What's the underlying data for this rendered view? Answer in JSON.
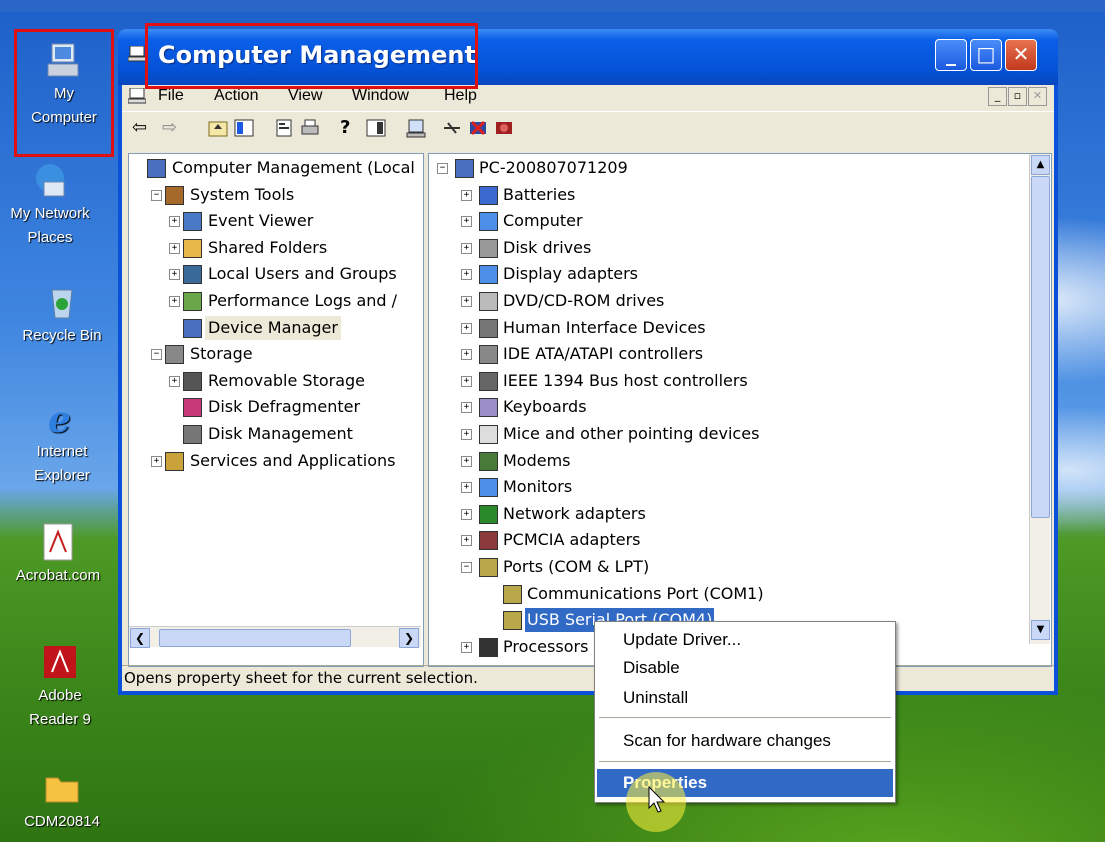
{
  "desktop": {
    "icons": [
      {
        "label_line1": "My",
        "label_line2": "Computer"
      },
      {
        "label_line1": "My Network",
        "label_line2": "Places"
      },
      {
        "label_line1": "Recycle Bin",
        "label_line2": ""
      },
      {
        "label_line1": "Internet",
        "label_line2": "Explorer"
      },
      {
        "label_line1": "Acrobat.com",
        "label_line2": ""
      },
      {
        "label_line1": "Adobe",
        "label_line2": "Reader 9"
      },
      {
        "label_line1": "CDM20814",
        "label_line2": ""
      }
    ]
  },
  "window": {
    "title": "Computer Management",
    "menu": [
      "File",
      "Action",
      "View",
      "Window",
      "Help"
    ],
    "status_text": "Opens property sheet for the current selection.",
    "left_tree": [
      "Computer Management (Local",
      "System Tools",
      "Event Viewer",
      "Shared Folders",
      "Local Users and Groups",
      "Performance Logs and /",
      "Device Manager",
      "Storage",
      "Removable Storage",
      "Disk Defragmenter",
      "Disk Management",
      "Services and Applications"
    ],
    "device_tree": [
      "PC-200807071209",
      "Batteries",
      "Computer",
      "Disk drives",
      "Display adapters",
      "DVD/CD-ROM drives",
      "Human Interface Devices",
      "IDE ATA/ATAPI controllers",
      "IEEE 1394 Bus host controllers",
      "Keyboards",
      "Mice and other pointing devices",
      "Modems",
      "Monitors",
      "Network adapters",
      "PCMCIA adapters",
      "Ports (COM & LPT)",
      "Communications Port (COM1)",
      "USB Serial Port (COM4)",
      "Processors"
    ]
  },
  "context_menu": {
    "items": [
      "Update Driver...",
      "Disable",
      "Uninstall",
      "Scan for hardware changes",
      "Properties"
    ]
  }
}
